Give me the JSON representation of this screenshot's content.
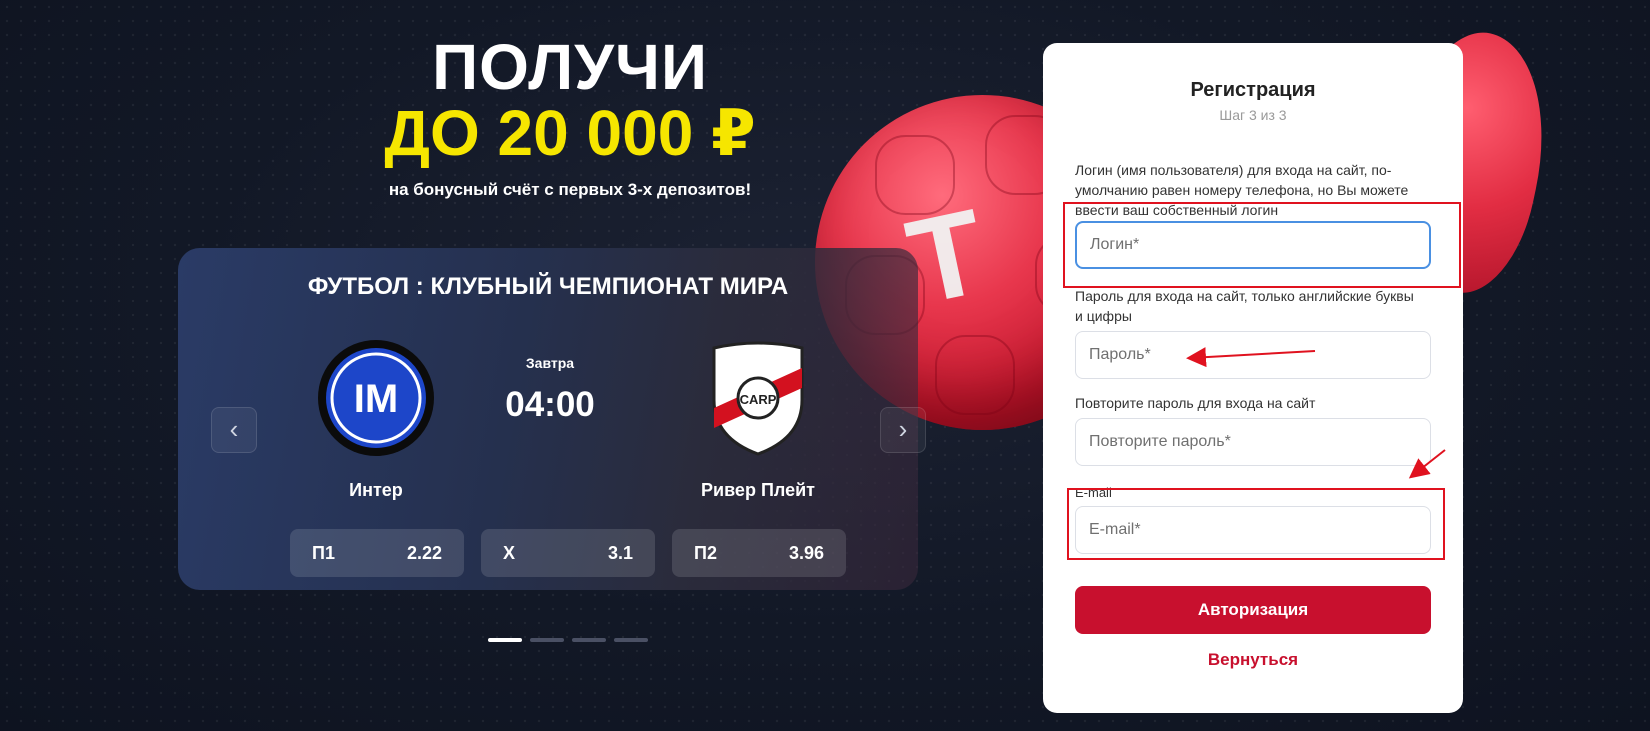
{
  "hero": {
    "line1": "ПОЛУЧИ",
    "line2": "ДО 20 000 ₽",
    "subtitle": "на бонусный счёт с первых 3-х депозитов!"
  },
  "background": {
    "ball_letter": "T"
  },
  "match_card": {
    "title": "ФУТБОЛ : КЛУБНЫЙ ЧЕМПИОНАТ МИРА",
    "day": "Завтра",
    "time": "04:00",
    "home_team": {
      "name": "Интер",
      "logo_icon": "inter-logo-icon",
      "logo_text": "IM"
    },
    "away_team": {
      "name": "Ривер Плейт",
      "logo_icon": "river-plate-logo-icon",
      "logo_text": "CARP"
    },
    "odds": [
      {
        "label": "П1",
        "value": "2.22"
      },
      {
        "label": "X",
        "value": "3.1"
      },
      {
        "label": "П2",
        "value": "3.96"
      }
    ],
    "prev_icon": "chevron-left-icon",
    "next_icon": "chevron-right-icon",
    "pager": {
      "count": 4,
      "active": 1
    }
  },
  "form": {
    "title": "Регистрация",
    "step": "Шаг 3 из 3",
    "login_label": "Логин (имя пользователя) для входа на сайт, по-умолчанию равен номеру телефона, но Вы можете ввести ваш собственный логин",
    "login_placeholder": "Логин*",
    "login_value": "",
    "password_label": "Пароль для входа на сайт, только английские буквы и цифры",
    "password_placeholder": "Пароль*",
    "password_value": "",
    "repeat_label": "Повторите пароль для входа на сайт",
    "repeat_placeholder": "Повторите пароль*",
    "repeat_value": "",
    "email_label": "E-mail",
    "email_placeholder": "E-mail*",
    "email_value": "",
    "submit_label": "Авторизация",
    "back_label": "Вернуться"
  },
  "colors": {
    "accent_red": "#c8102e",
    "hero_yellow": "#f6e600",
    "annotation_red": "#e0121f",
    "focus_blue": "#4a90e2"
  }
}
